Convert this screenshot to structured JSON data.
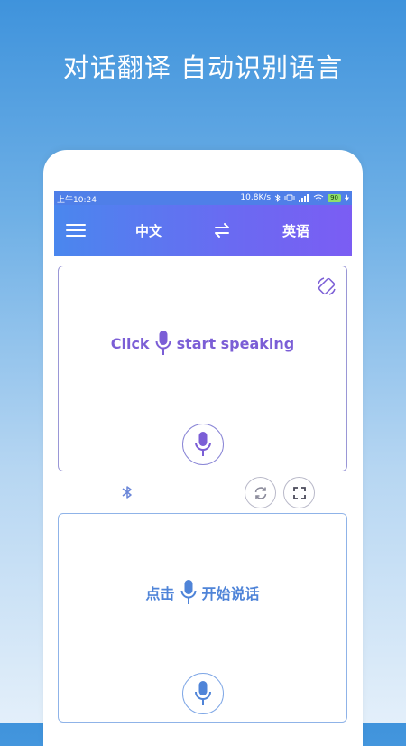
{
  "headline": "对话翻译 自动识别语言",
  "status_bar": {
    "time": "上午10:24",
    "network_speed": "10.8K/s",
    "battery": "90"
  },
  "toolbar": {
    "menu_icon": "hamburger-menu-icon",
    "source_language": "中文",
    "target_language": "英语",
    "swap_icon": "swap-arrows-icon"
  },
  "top_panel": {
    "prompt_before_icon": "Click",
    "prompt_after_icon": "start speaking",
    "rotate_icon": "rotate-screen-icon",
    "mic_icon": "microphone-icon"
  },
  "middle_bar": {
    "bluetooth_icon": "bluetooth-icon",
    "refresh_icon": "refresh-icon",
    "fullscreen_icon": "fullscreen-icon"
  },
  "bottom_panel": {
    "prompt_before_icon": "点击",
    "prompt_after_icon": "开始说话",
    "mic_icon": "microphone-icon"
  },
  "colors": {
    "toolbar_start": "#4a87ee",
    "toolbar_end": "#7b5df3",
    "top_accent": "#7b5ed6",
    "bottom_accent": "#4f84d8"
  }
}
